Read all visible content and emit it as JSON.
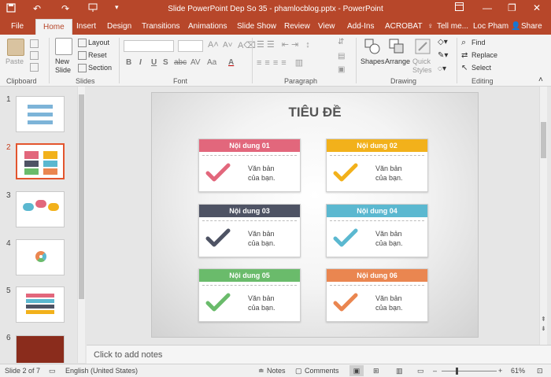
{
  "titlebar": {
    "title": "Slide PowerPoint Dep So 35 - phamlocblog.pptx - PowerPoint",
    "bg": "#b7472a"
  },
  "tabs": [
    {
      "label": "File"
    },
    {
      "label": "Home"
    },
    {
      "label": "Insert"
    },
    {
      "label": "Design"
    },
    {
      "label": "Transitions"
    },
    {
      "label": "Animations"
    },
    {
      "label": "Slide Show"
    },
    {
      "label": "Review"
    },
    {
      "label": "View"
    },
    {
      "label": "Add-Ins"
    },
    {
      "label": "ACROBAT"
    },
    {
      "label": "Tell me..."
    }
  ],
  "user": {
    "name": "Loc Pham",
    "share": "Share"
  },
  "ribbon": {
    "clipboard": {
      "paste": "Paste",
      "group": "Clipboard"
    },
    "slides": {
      "new_slide": "New Slide",
      "layout": "Layout",
      "reset": "Reset",
      "section": "Section",
      "group": "Slides"
    },
    "font": {
      "group": "Font",
      "bold": "B",
      "italic": "I",
      "underline": "U",
      "shadow": "S",
      "strike": "abc",
      "spacing": "AV",
      "case": "Aa",
      "color": "A"
    },
    "paragraph": {
      "group": "Paragraph"
    },
    "drawing": {
      "shapes": "Shapes",
      "arrange": "Arrange",
      "quick_styles": "Quick Styles",
      "group": "Drawing"
    },
    "editing": {
      "find": "Find",
      "replace": "Replace",
      "select": "Select",
      "group": "Editing"
    }
  },
  "thumbnails": [
    {
      "num": "1"
    },
    {
      "num": "2"
    },
    {
      "num": "3"
    },
    {
      "num": "4"
    },
    {
      "num": "5"
    },
    {
      "num": "6"
    }
  ],
  "slide": {
    "title": "TIÊU ĐỀ",
    "cards": [
      {
        "heading": "Nội dung 01",
        "body1": "Văn bản",
        "body2": "của bạn.",
        "color": "#e2677c"
      },
      {
        "heading": "Nội dung 02",
        "body1": "Văn bản",
        "body2": "của bạn.",
        "color": "#f2b11b"
      },
      {
        "heading": "Nội dung 03",
        "body1": "Văn bản",
        "body2": "của bạn.",
        "color": "#4e5364"
      },
      {
        "heading": "Nội dung 04",
        "body1": "Văn bản",
        "body2": "của bạn.",
        "color": "#5bb8d0"
      },
      {
        "heading": "Nội dung 05",
        "body1": "Văn bản",
        "body2": "của bạn.",
        "color": "#6abb6b"
      },
      {
        "heading": "Nội dung 06",
        "body1": "Văn bản",
        "body2": "của bạn.",
        "color": "#ea8650"
      }
    ]
  },
  "notes": {
    "placeholder": "Click to add notes"
  },
  "status": {
    "slide": "Slide 2 of 7",
    "language": "English (United States)",
    "notes": "Notes",
    "comments": "Comments",
    "zoom": "61%"
  },
  "accent": "#b7472a"
}
